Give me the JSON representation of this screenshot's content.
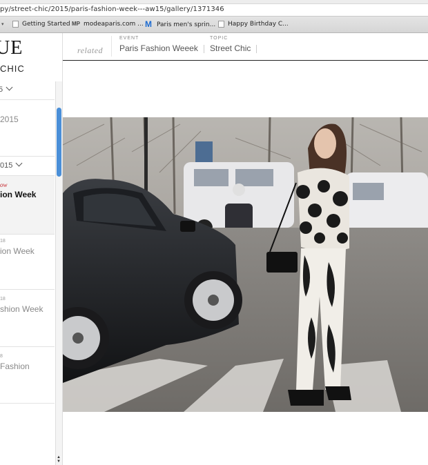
{
  "browser": {
    "url": "py/street-chic/2015/paris-fashion-week---aw15/gallery/1371346",
    "bookmarks": [
      {
        "label": "Getting Started",
        "icon": "page-icon"
      },
      {
        "label": "modeaparis.com ...",
        "icon": "mp-icon"
      },
      {
        "label": "Paris men's sprin...",
        "icon": "m-icon"
      },
      {
        "label": "Happy Birthday C...",
        "icon": "page-icon"
      }
    ],
    "mp_glyph": "MP",
    "m_glyph": "M"
  },
  "sidebar": {
    "logo": "UE",
    "section": "CHIC",
    "year_filter": "5",
    "items": [
      {
        "text": "2015"
      },
      {
        "text": "015"
      },
      {
        "badge": "ow",
        "text": "ion Week"
      },
      {
        "sup": "18",
        "text": "ion Week"
      },
      {
        "sup": "18",
        "text": "shion Week"
      },
      {
        "sup": "8",
        "text": "Fashion"
      }
    ]
  },
  "related": {
    "label": "related",
    "event_category": "EVENT",
    "event_value": "Paris Fashion Weeek",
    "topic_category": "TOPIC",
    "topic_value": "Street Chic"
  }
}
